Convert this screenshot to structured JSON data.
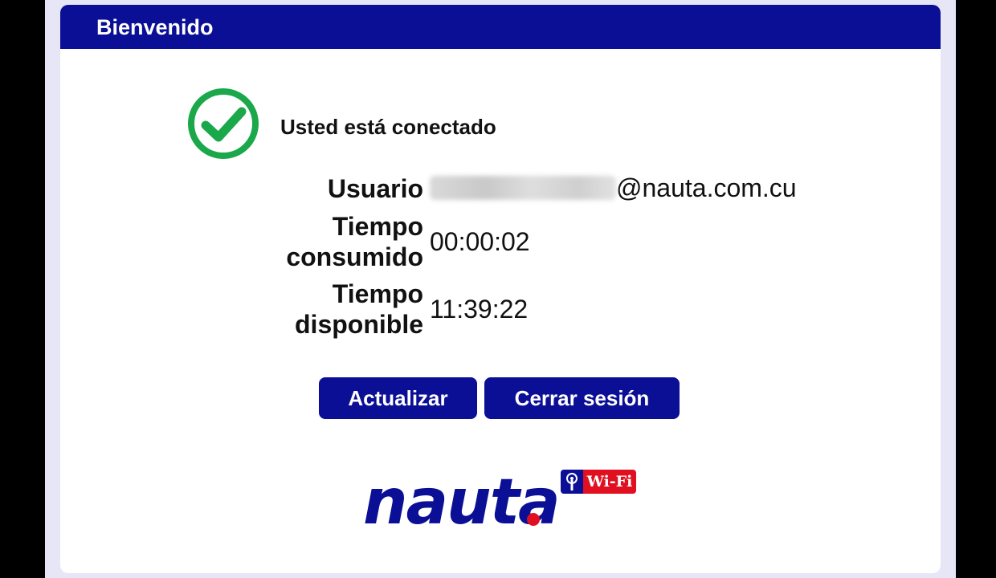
{
  "header": {
    "title": "Bienvenido"
  },
  "status": {
    "icon": "check-circle-icon",
    "text": "Usted está conectado",
    "color": "#1aa84a"
  },
  "info": {
    "user_label": "Usuario",
    "user_domain": "@nauta.com.cu",
    "time_used_label": "Tiempo consumido",
    "time_used_value": "00:00:02",
    "time_left_label": "Tiempo disponible",
    "time_left_value": "11:39:22"
  },
  "buttons": {
    "refresh_label": "Actualizar",
    "logout_label": "Cerrar sesión"
  },
  "logo": {
    "word": "nauta",
    "badge": "Wi-Fi",
    "wifi_icon": "wifi-antenna-icon"
  },
  "colors": {
    "brand_blue": "#0a0f96",
    "brand_red": "#e01020",
    "page_bg": "#e6e6f7"
  }
}
